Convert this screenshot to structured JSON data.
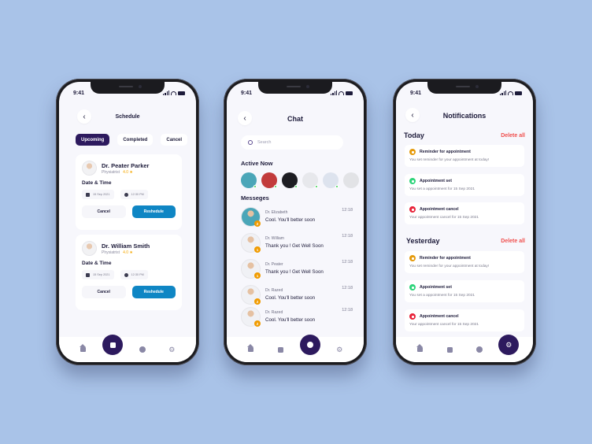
{
  "status_bar": {
    "time": "9:41"
  },
  "colors": {
    "background": "#A9C3E8",
    "primary": "#2D1A5E",
    "reschedule": "#0F86C4",
    "rating": "#F5A700",
    "online": "#37D14C",
    "badge": "#F09B00",
    "delete": "#F0504E",
    "reminder": "#E59A0C",
    "set": "#2ED47A",
    "cancel": "#E8243A"
  },
  "schedule": {
    "title": "Schedule",
    "tabs": [
      {
        "label": "Upcoming",
        "active": true
      },
      {
        "label": "Completed",
        "active": false
      },
      {
        "label": "Cancel",
        "active": false
      }
    ],
    "appointments": [
      {
        "doctor": "Dr. Peater Parker",
        "specialty": "Physiatrist",
        "rating": "4.0 ★",
        "dt_label": "Date & Time",
        "date": "15 Sep 2021",
        "time": "12:30 PM",
        "cancel": "Cancel",
        "reschedule": "Reshedule"
      },
      {
        "doctor": "Dr. William Smith",
        "specialty": "Physiatrist",
        "rating": "4.0 ★",
        "dt_label": "Date & Time",
        "date": "15 Sep 2021",
        "time": "12:30 PM",
        "cancel": "Cancel",
        "reschedule": "Reshedule"
      }
    ]
  },
  "chat": {
    "title": "Chat",
    "search_placeholder": "Search",
    "active_now_label": "Active Now",
    "messages_label": "Messeges",
    "active_users": [
      {
        "bg": "#4BA6B8",
        "online": true
      },
      {
        "bg": "#C23B3B",
        "online": true
      },
      {
        "bg": "#1D1D22",
        "online": true
      },
      {
        "bg": "#E7E8EC",
        "online": true
      },
      {
        "bg": "#DDE3EE",
        "online": true
      },
      {
        "bg": "#E2E3E6",
        "online": false
      }
    ],
    "messages": [
      {
        "name": "Dr. Elizabeth",
        "text": "Cool. You'll better soon",
        "time": "12:18",
        "unread": "2"
      },
      {
        "name": "Dr. William",
        "text": "Thank you ! Get Well Soon",
        "time": "12:18",
        "unread": "1"
      },
      {
        "name": "Dr. Peater",
        "text": "Thank you ! Get Well Soon",
        "time": "12:18",
        "unread": "1"
      },
      {
        "name": "Dr. Razed",
        "text": "Cool. You'll better soon",
        "time": "12:18",
        "unread": "2"
      },
      {
        "name": "Dr. Razed",
        "text": "Cool. You'll better soon",
        "time": "12:18",
        "unread": "2"
      }
    ]
  },
  "notifications": {
    "title": "Notifications",
    "groups": [
      {
        "heading": "Today",
        "delete_label": "Delete all",
        "items": [
          {
            "type": "reminder",
            "title": "Reminder for appointment",
            "desc": "You set reminder for your appointment at today!"
          },
          {
            "type": "set",
            "title": "Appointment set",
            "desc": "You set a appointment for 15 Sep 2021"
          },
          {
            "type": "cancel",
            "title": "Appointment cancel",
            "desc": "Your appointment cancel for 15 Sep 2021"
          }
        ]
      },
      {
        "heading": "Yesterday",
        "delete_label": "Delete all",
        "items": [
          {
            "type": "reminder",
            "title": "Reminder for appointment",
            "desc": "You set reminder for your appointment at today!"
          },
          {
            "type": "set",
            "title": "Appointment set",
            "desc": "You set a appointment for 15 Sep 2021"
          },
          {
            "type": "cancel",
            "title": "Appointment cancel",
            "desc": "Your appointment cancel for 15 Sep 2021"
          }
        ]
      }
    ]
  },
  "bottom_nav": {
    "items": [
      "home-icon",
      "calendar-icon",
      "chat-icon",
      "settings-icon"
    ],
    "active_per_screen": [
      "calendar-icon",
      "chat-icon",
      "settings-icon"
    ]
  }
}
